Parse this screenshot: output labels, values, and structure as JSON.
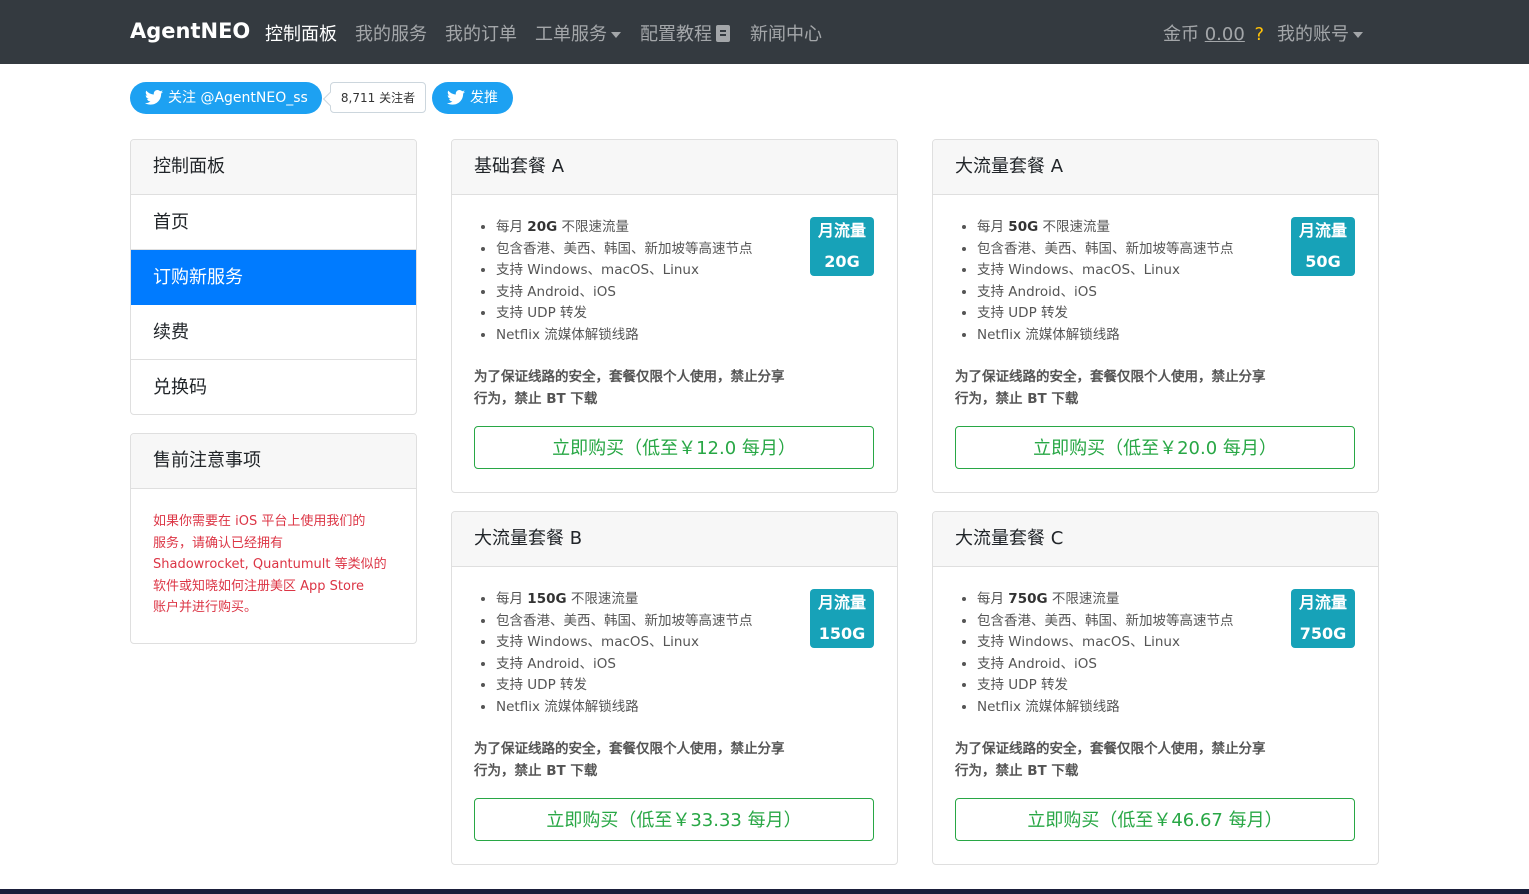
{
  "navbar": {
    "brand": "AgentNEO",
    "items": [
      {
        "label": "控制面板",
        "active": true
      },
      {
        "label": "我的服务"
      },
      {
        "label": "我的订单"
      },
      {
        "label": "工单服务"
      },
      {
        "label": "配置教程"
      },
      {
        "label": "新闻中心"
      }
    ],
    "coin_label": "金币",
    "coin_value": "0.00",
    "coin_help": "?",
    "account_label": "我的账号"
  },
  "twitter": {
    "follow_label": "关注 @AgentNEO_ss",
    "followers_count": "8,711 关注者",
    "tweet_label": "发推"
  },
  "sidebar": {
    "title": "控制面板",
    "items": [
      {
        "label": "首页"
      },
      {
        "label": "订购新服务",
        "active": true
      },
      {
        "label": "续费"
      },
      {
        "label": "兑换码"
      }
    ],
    "notice_title": "售前注意事项",
    "notice_lines": [
      "如果你需要在 iOS 平台上使用我们的",
      "服务，请确认已经拥有",
      "Shadowrocket, Quantumult 等类似的",
      "软件或知晓如何注册美区 App Store",
      "账户并进行购买。"
    ]
  },
  "plans": [
    {
      "title": "基础套餐 A",
      "feature_prefix": "每月 ",
      "traffic": "20G",
      "feature_suffix": " 不限速流量",
      "features": [
        "包含香港、美西、韩国、新加坡等高速节点",
        "支持 Windows、macOS、Linux",
        "支持 Android、iOS",
        "支持 UDP 转发",
        "Netflix 流媒体解锁线路"
      ],
      "badge_label": "月流量",
      "badge_value": "20G",
      "warning_lines": [
        "为了保证线路的安全，套餐仅限个人使用，禁止分享",
        "行为，禁止 BT 下载"
      ],
      "buy_label": "立即购买（低至￥12.0 每月）"
    },
    {
      "title": "大流量套餐 A",
      "feature_prefix": "每月 ",
      "traffic": "50G",
      "feature_suffix": " 不限速流量",
      "features": [
        "包含香港、美西、韩国、新加坡等高速节点",
        "支持 Windows、macOS、Linux",
        "支持 Android、iOS",
        "支持 UDP 转发",
        "Netflix 流媒体解锁线路"
      ],
      "badge_label": "月流量",
      "badge_value": "50G",
      "warning_lines": [
        "为了保证线路的安全，套餐仅限个人使用，禁止分享",
        "行为，禁止 BT 下载"
      ],
      "buy_label": "立即购买（低至￥20.0 每月）"
    },
    {
      "title": "大流量套餐 B",
      "feature_prefix": "每月 ",
      "traffic": "150G",
      "feature_suffix": " 不限速流量",
      "features": [
        "包含香港、美西、韩国、新加坡等高速节点",
        "支持 Windows、macOS、Linux",
        "支持 Android、iOS",
        "支持 UDP 转发",
        "Netflix 流媒体解锁线路"
      ],
      "badge_label": "月流量",
      "badge_value": "150G",
      "warning_lines": [
        "为了保证线路的安全，套餐仅限个人使用，禁止分享",
        "行为，禁止 BT 下载"
      ],
      "buy_label": "立即购买（低至￥33.33 每月）"
    },
    {
      "title": "大流量套餐 C",
      "feature_prefix": "每月 ",
      "traffic": "750G",
      "feature_suffix": " 不限速流量",
      "features": [
        "包含香港、美西、韩国、新加坡等高速节点",
        "支持 Windows、macOS、Linux",
        "支持 Android、iOS",
        "支持 UDP 转发",
        "Netflix 流媒体解锁线路"
      ],
      "badge_label": "月流量",
      "badge_value": "750G",
      "warning_lines": [
        "为了保证线路的安全，套餐仅限个人使用，禁止分享",
        "行为，禁止 BT 下载"
      ],
      "buy_label": "立即购买（低至￥46.67 每月）"
    }
  ],
  "colors": {
    "navbar": "#343a40",
    "primary": "#007bff",
    "success": "#28a745",
    "info": "#17a2b8",
    "danger": "#dc3545",
    "twitter": "#1da1f2",
    "warning": "#ffc107"
  }
}
